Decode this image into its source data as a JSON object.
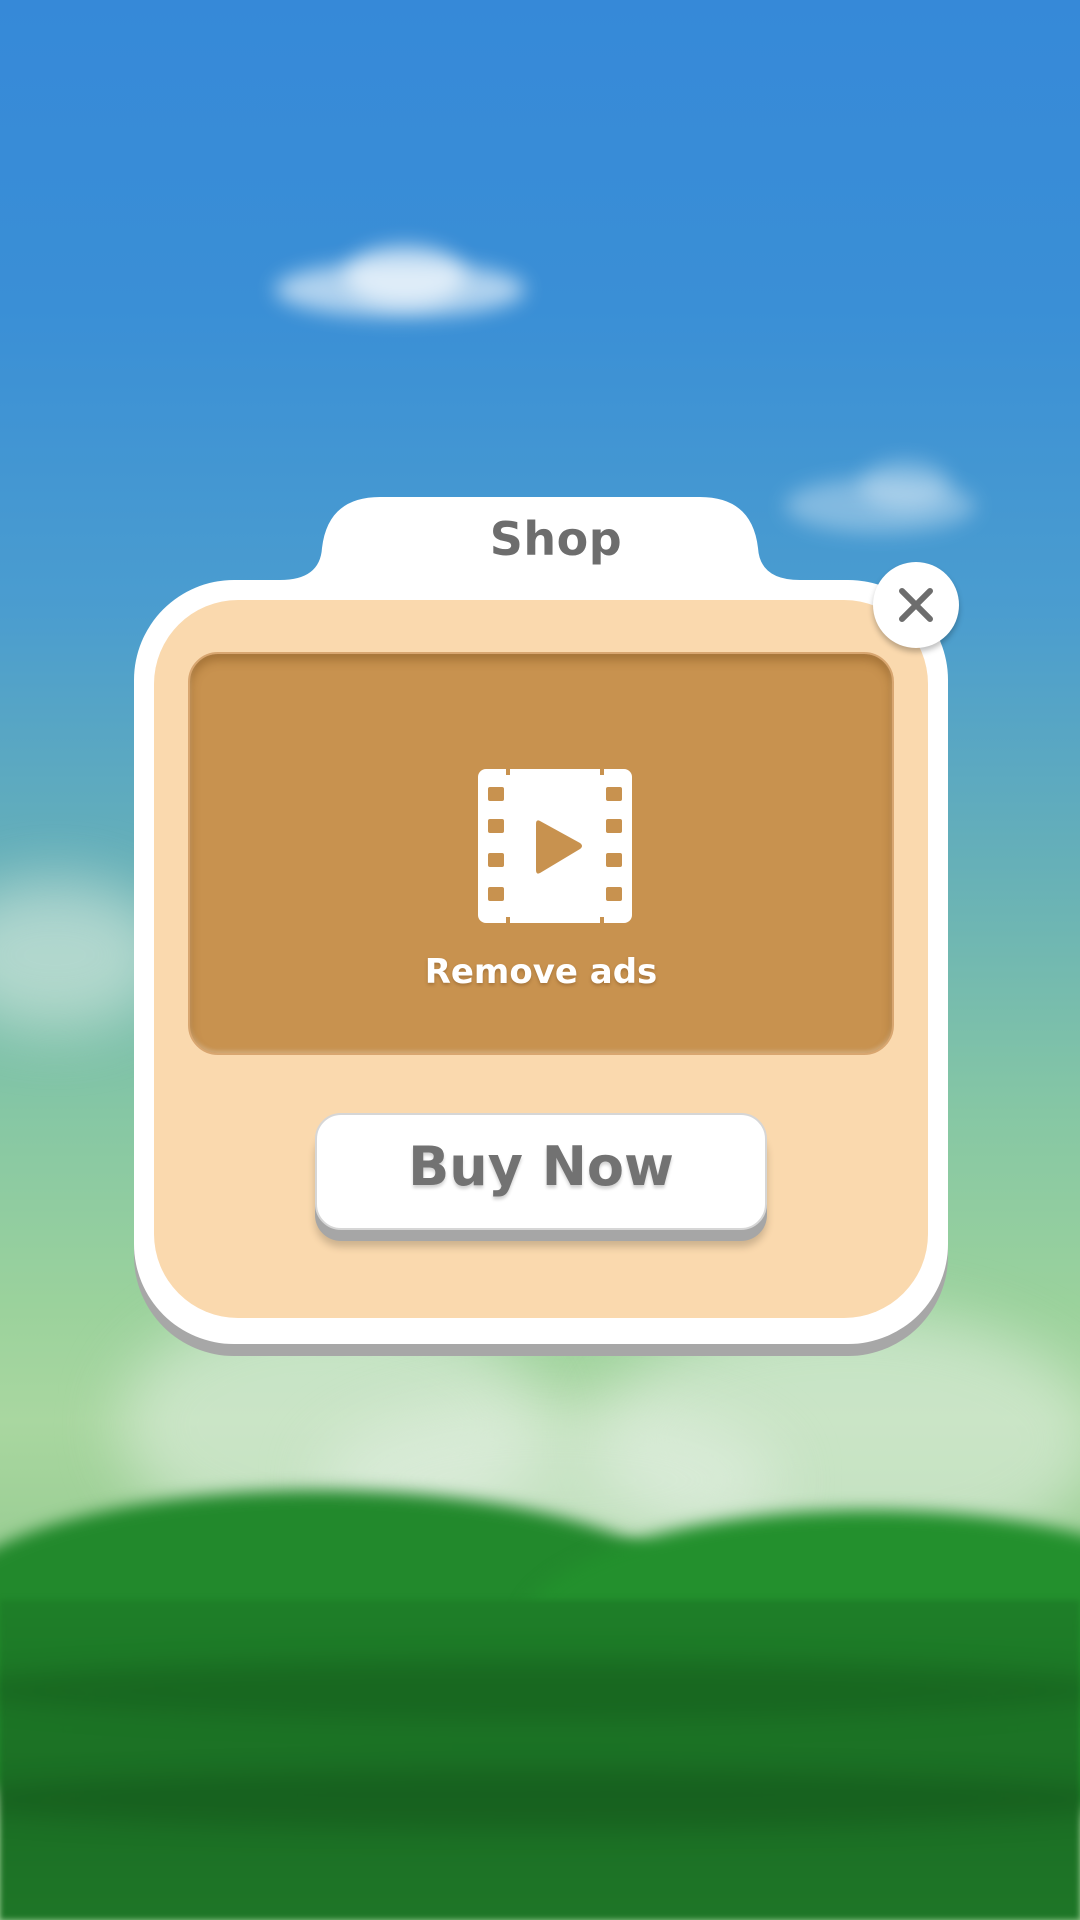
{
  "shop_dialog": {
    "title": "Shop",
    "feature": {
      "icon": "film-play-icon",
      "label": "Remove ads"
    },
    "buy_button_label": "Buy Now",
    "close_icon": "close-icon"
  },
  "colors": {
    "panel": "#fad9ae",
    "feature_box": "#c8924f",
    "text_gray": "#6d6d6d",
    "frame": "#ffffff"
  }
}
